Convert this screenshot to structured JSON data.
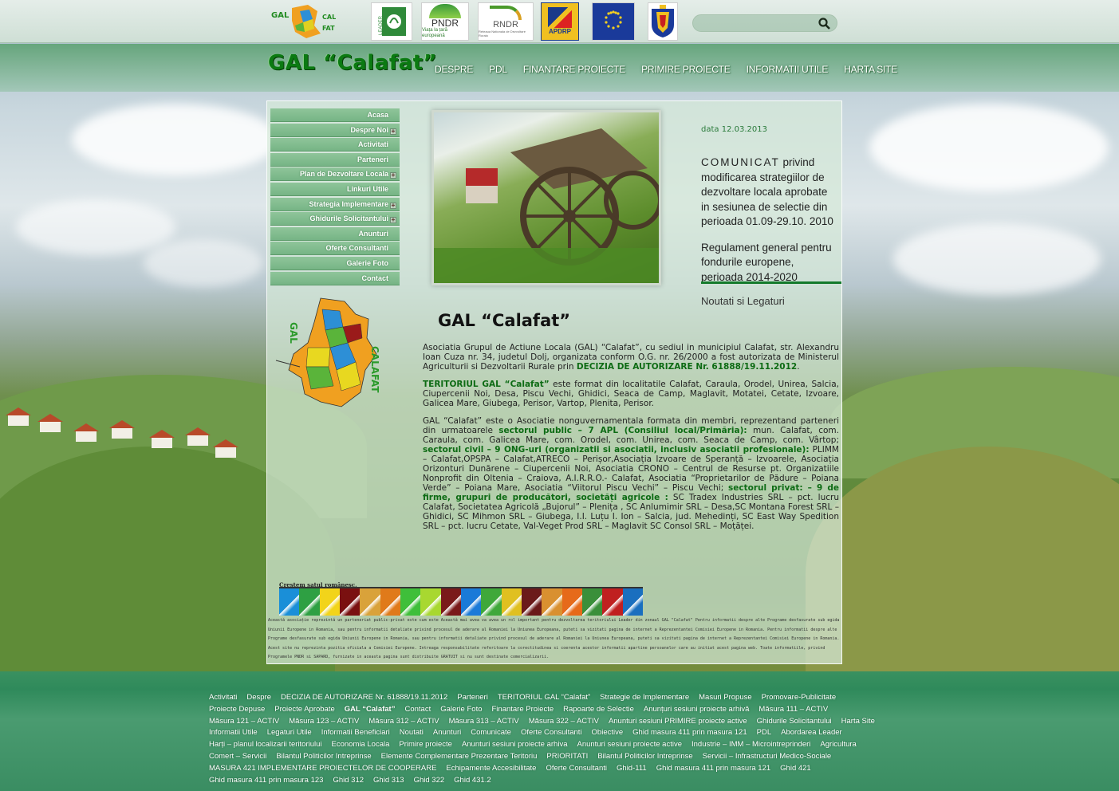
{
  "header": {
    "partners": [
      {
        "icon": "gal-calafat-logo-icon",
        "label": ""
      },
      {
        "icon": "leader-logo-icon",
        "label": "LEADER"
      },
      {
        "icon": "pndr-logo-icon",
        "label": "PNDR",
        "sub": "Viața la țară europeană"
      },
      {
        "icon": "rndr-logo-icon",
        "label": "RNDR",
        "sub": "Reteaua Nationala de Dezvoltare Rurala"
      },
      {
        "icon": "apdrp-logo-icon",
        "label": "APDRP"
      },
      {
        "icon": "eu-flag-icon",
        "label": ""
      },
      {
        "icon": "romania-coat-of-arms-icon",
        "label": ""
      }
    ],
    "search": {
      "placeholder": "",
      "value": ""
    }
  },
  "site_title": "GAL “Calafat”",
  "topnav": [
    "DESPRE",
    "PDL",
    "FINANTARE PROIECTE",
    "PRIMIRE PROIECTE",
    "INFORMATII UTILE",
    "HARTA SITE"
  ],
  "sidebar": {
    "items": [
      {
        "label": "Acasa",
        "has_sub": false
      },
      {
        "label": "Despre Noi",
        "has_sub": true
      },
      {
        "label": "Activitati",
        "has_sub": false
      },
      {
        "label": "Parteneri",
        "has_sub": false
      },
      {
        "label": "Plan de Dezvoltare Locala",
        "has_sub": true
      },
      {
        "label": "Linkuri Utile",
        "has_sub": false
      },
      {
        "label": "Strategia Implementare",
        "has_sub": true
      },
      {
        "label": "Ghidurile Solicitantului",
        "has_sub": true
      },
      {
        "label": "Anunturi",
        "has_sub": false
      },
      {
        "label": "Oferte Consultanti",
        "has_sub": false
      },
      {
        "label": "Galerie Foto",
        "has_sub": false
      },
      {
        "label": "Contact",
        "has_sub": false
      }
    ]
  },
  "news": {
    "date": "data 12.03.2013",
    "item1_lead": "COMUNICAT",
    "item1_rest": " privind modificarea strategiilor de dezvoltare locala aprobate in sesiunea de selectie din perioada 01.09-29.10. 2010",
    "item2": "Regulament general pentru fondurile europene, perioada 2014-2020",
    "links_label": "Noutati si Legaturi"
  },
  "main": {
    "heading": "GAL “Calafat”",
    "p1_text": "Asociatia Grupul de Actiune Locala (GAL) “Calafat”,  cu sediul in municipiul Calafat, str. Alexandru Ioan Cuza nr. 34, judetul Dolj, organizata conform O.G. nr. 26/2000 a fost autorizata de Ministerul Agriculturii si Dezvoltarii Rurale prin ",
    "p1_bold": "DECIZIA DE AUTORIZARE Nr. 61888/19.11.2012",
    "p2_bold": "TERITORIUL GAL “Calafat”",
    "p2_text": "  este format din localitatile Calafat, Caraula,  Orodel, Unirea,  Salcia, Ciupercenii Noi,  Desa, Piscu Vechi, Ghidici, Seaca de Camp, Maglavit, Motatei, Cetate, Izvoare, Galicea Mare, Giubega, Perisor, Vartop, Plenita, Perisor.",
    "p3_a": "GAL “Calafat” este o Asociatie nonguvernamentala formata din membri, reprezentand parteneri din urmatoarele ",
    "p3_b": "sectorul public –  7 APL (Consiliul local/Primăria):",
    "p3_c": " mun. Calafat,  com. Caraula,  com. Galicea Mare,  com. Orodel, com. Unirea,  com. Seaca de Camp,  com. Vârtop; ",
    "p3_d": "sectorul civil – 9  ONG-uri (organizatii si asociatii, inclusiv asociatii profesionale):",
    "p3_e": " PLIMM – Calafat,OPSPA – Calafat,ATRECO – Perișor,Asociația Izvoare de  Speranță – Izvoarele, Asociația Orizonturi Dunărene – Ciupercenii Noi, Asociatia CRONO – Centrul de Resurse pt. Organizatiile Nonprofit din Oltenia – Craiova, A.I.R.R.O.- Calafat, Asociatia “Proprietarilor de Pădure – Poiana Verde” – Poiana Mare, Asociatia “Viitorul Piscu Vechi” – Piscu Vechi; ",
    "p3_f": "sectorul privat: – 9 de firme, grupuri de producători, societăți agricole :",
    "p3_g": " SC Tradex Industries SRL – pct. lucru Calafat, Societatea Agricolă „Bujorul” – Plenița , SC  Anlumimir SRL – Desa,SC Montana Forest SRL – Ghidici, SC Mihmon SRL – Giubega, I.I.  Luțu I. Ion –  Salcia, jud. Mehedinți, SC East Way Spedition SRL – pct. lucru Cetate,  Val-Veget Prod SRL – Maglavit SC Consol SRL – Moțăței."
  },
  "banner": {
    "label": "Creștem satul românesc.",
    "colors": [
      "#1a8fd8",
      "#2ea043",
      "#f2d41a",
      "#7a1010",
      "#d9a23a",
      "#e07a1a",
      "#3fbf3a",
      "#a8d830",
      "#7a1a1a",
      "#1a7ad8",
      "#3fa83a",
      "#e0c020",
      "#6b1a1a",
      "#d99030",
      "#e66a1a",
      "#3a8f3a",
      "#c02020",
      "#1a6fbf"
    ]
  },
  "disclaimer": "Această asociație reprezintă un parteneriat public-privat este cum este Această mai avea va avea un rol important pentru dezvoltarea teritoriului Leader din zonaul GAL \"Calafat\" Pentru informatii despre alte Programe desfasurate sub egida Uniunii Europene in Romania, sau pentru informatii detaliate privind procesul de aderare al Romaniei la Uniunea Europeana, puteti sa vizitati pagina de internet a Reprezentantei Comisiei Europene in Romania. Pentru informatii despre alte Programe desfasurate sub egida Uniunii Europene in Romania, sau pentru informatii detaliate privind procesul de aderare al Romaniei la Uniunea Europeana, puteti sa vizitati pagina de internet a Reprezentantei Comisiei Europene in Romania. Acest site nu reprezinta pozitia oficiala a Comisiei Europene. Intreaga responsabilitate referitoare la corectitudinea si coerenta acestor informatii apartine persoanelor care au initiat acest pagina web. Toate informatiile, privind Programele PNDR si SAPARD, furnizate in aceasta pagina sunt distribuite GRATUIT si nu sunt destinate comercializarii.",
  "footer": {
    "links": [
      "Activitati",
      "Despre",
      "DECIZIA DE AUTORIZARE Nr. 61888/19.11.2012",
      "Parteneri",
      "TERITORIUL GAL “Calafat”",
      "Strategie de Implementare",
      "Masuri Propuse",
      "Promovare-Publicitate",
      "Proiecte Depuse",
      "Proiecte Aprobate",
      "GAL “Calafat”",
      "Contact",
      "Galerie Foto",
      "Finantare Proiecte",
      "Rapoarte de Selectie",
      "Anunțuri sesiuni proiecte arhivă",
      "Măsura 111 – ACTIV",
      "Măsura 121 – ACTIV",
      "Măsura 123 – ACTIV",
      "Măsura 312 – ACTIV",
      "Măsura 313 – ACTIV",
      "Măsura 322 – ACTIV",
      "Anunturi sesiuni PRIMIRE proiecte active",
      "Ghidurile Solicitantului",
      "Harta Site",
      "Informatii Utile",
      "Legaturi Utile",
      "Informatii Beneficiari",
      "Noutati",
      "Anunturi",
      "Comunicate",
      "Oferte Consultanti",
      "Obiective",
      "Ghid masura 411 prin masura 121",
      "PDL",
      "Abordarea Leader",
      "Harți – planul localizarii teritoriului",
      "Economia Locala",
      "Primire proiecte",
      "Anunturi sesiuni proiecte arhiva",
      "Anunturi sesiuni proiecte active",
      "Industrie – IMM – Microintreprinderi",
      "Agricultura",
      "Comert – Servicii",
      "Bilantul Politicilor Intreprinse",
      "Elemente Complementare Prezentare Teritoriu",
      "PRIORITATI",
      "Bilantul Politicilor Intreprinse",
      "Servicii – Infrastructuri Medico-Sociale",
      "MASURA 421 IMPLEMENTARE PROIECTELOR DE COOPERARE",
      "Echipamente Accesibilitate",
      "Oferte Consultanti",
      "Ghid-111",
      "Ghid masura 411 prin masura 121",
      "Ghid 421",
      "Ghid masura 411 prin masura 123",
      "Ghid 312",
      "Ghid 313",
      "Ghid 322",
      "Ghid 431.2"
    ],
    "active": "GAL “Calafat”"
  },
  "colors": {
    "accent_green": "#137a2b",
    "menu_green": "#7bb889",
    "footer_green": "#3a9160"
  }
}
